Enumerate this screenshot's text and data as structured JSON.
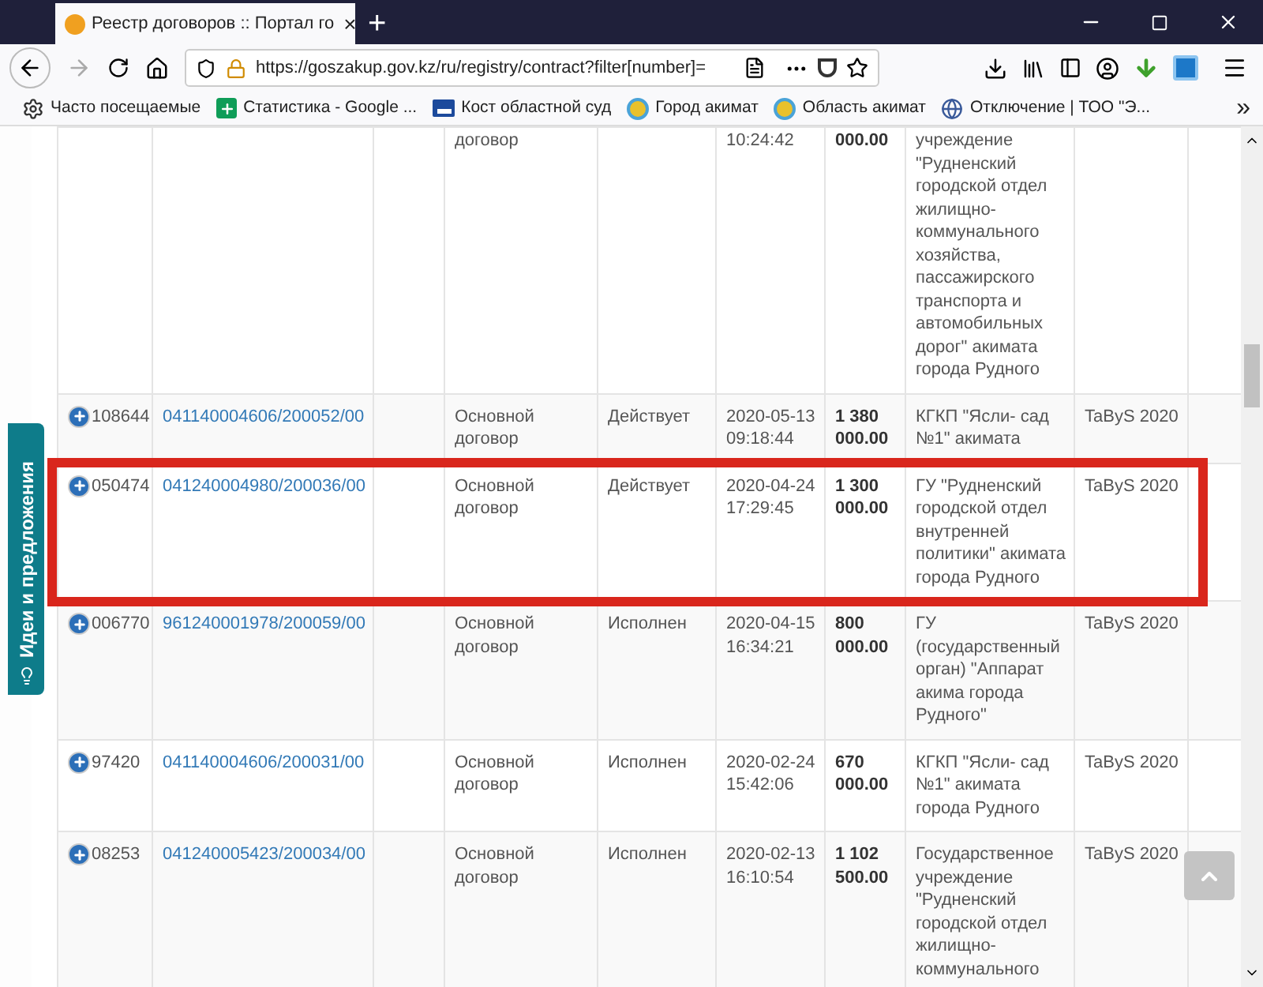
{
  "browser": {
    "tab": {
      "title": "Реестр договоров :: Портал го",
      "close": "×"
    },
    "new_tab": "+",
    "url": "https://goszakup.gov.kz/ru/registry/contract?filter[number]=",
    "bookmarks": [
      {
        "label": "Часто посещаемые",
        "kind": "gear"
      },
      {
        "label": "Статистика - Google ...",
        "kind": "sheet"
      },
      {
        "label": "Кост областной суд",
        "kind": "court"
      },
      {
        "label": "Город акимат",
        "kind": "emblem"
      },
      {
        "label": "Область акимат",
        "kind": "emblem"
      },
      {
        "label": "Отключение | ТОО \"Э...",
        "kind": "globe"
      }
    ],
    "overflow": "»"
  },
  "feedback_tab": {
    "label": "Идеи и предложения"
  },
  "table": {
    "rows": [
      {
        "type": "договор",
        "datetime": "10:24:42",
        "amount": "000.00",
        "customer": "учреждение \"Рудненский городской отдел жилищно-коммунального хозяйства, пассажирского транспорта и автомобильных дорог\" акимата города Рудного",
        "highlighted": false
      },
      {
        "number": "108644",
        "contract": "041140004606/200052/00",
        "type": "Основной договор",
        "status": "Действует",
        "datetime": "2020-05-13 09:18:44",
        "amount": "1 380 000.00",
        "customer": "КГКП \"Ясли- сад №1\" акимата",
        "system": "TaByS 2020",
        "highlighted": false
      },
      {
        "number": "050474",
        "contract": "041240004980/200036/00",
        "type": "Основной договор",
        "status": "Действует",
        "datetime": "2020-04-24 17:29:45",
        "amount": "1 300 000.00",
        "customer": "ГУ \"Рудненский городской отдел внутренней политики\" акимата города Рудного",
        "system": "TaByS 2020",
        "highlighted": true
      },
      {
        "number": "006770",
        "contract": "961240001978/200059/00",
        "type": "Основной договор",
        "status": "Исполнен",
        "datetime": "2020-04-15 16:34:21",
        "amount": "800 000.00",
        "customer": "ГУ (государственный орган) \"Аппарат акима города Рудного\"",
        "system": "TaByS 2020",
        "highlighted": false
      },
      {
        "number": "97420",
        "contract": "041140004606/200031/00",
        "type": "Основной договор",
        "status": "Исполнен",
        "datetime": "2020-02-24 15:42:06",
        "amount": "670 000.00",
        "customer": "КГКП \"Ясли- сад №1\" акимата города Рудного",
        "system": "TaByS 2020",
        "highlighted": false
      },
      {
        "number": "08253",
        "contract": "041240005423/200034/00",
        "type": "Основной договор",
        "status": "Исполнен",
        "datetime": "2020-02-13 16:10:54",
        "amount": "1 102 500.00",
        "customer": "Государственное учреждение \"Рудненский городской отдел жилищно-коммунального",
        "system": "TaByS 2020",
        "highlighted": false
      }
    ]
  }
}
